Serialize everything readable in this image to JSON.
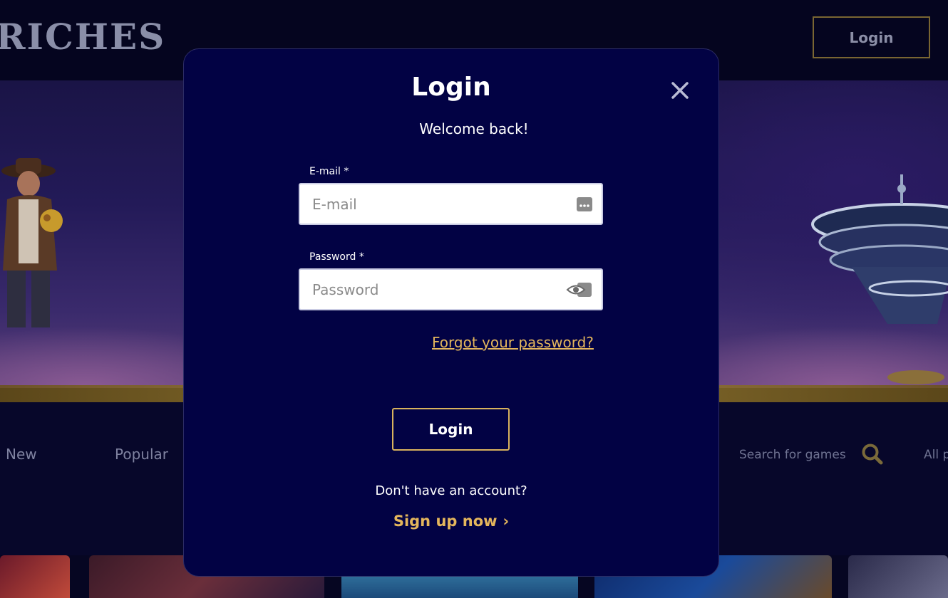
{
  "header": {
    "logo_text": "RICHES",
    "login_label": "Login"
  },
  "games": {
    "categories": [
      "New",
      "Popular"
    ],
    "search_placeholder": "Search for games",
    "all_providers": "All p"
  },
  "modal": {
    "title": "Login",
    "welcome": "Welcome back!",
    "email_label": "E-mail *",
    "email_placeholder": "E-mail",
    "password_label": "Password *",
    "password_placeholder": "Password",
    "forgot_link": "Forgot your password?",
    "submit_label": "Login",
    "no_account_text": "Don't have an account?",
    "signup_label": "Sign up now",
    "signup_chevron": "›"
  },
  "colors": {
    "accent_gold": "#e4b65c",
    "modal_bg": "#020244",
    "page_bg": "#060622"
  },
  "icons": [
    "close-icon",
    "password-manager-icon",
    "eye-icon",
    "search-icon",
    "chevron-right-icon"
  ]
}
